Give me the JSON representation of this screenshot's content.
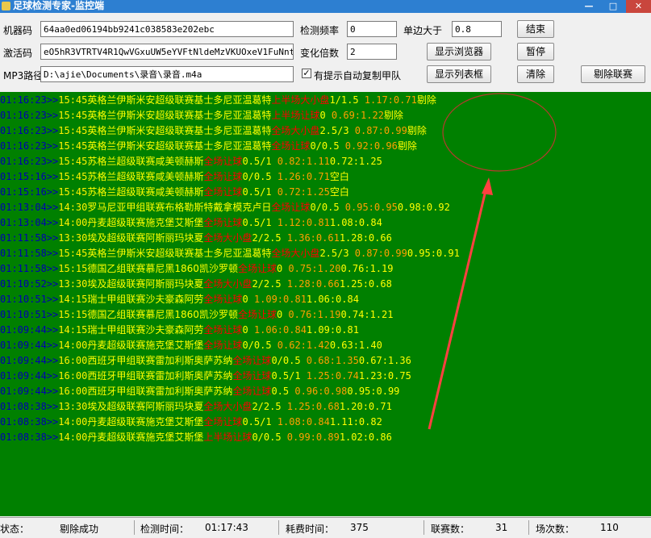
{
  "window": {
    "title": "足球检测专家-监控端",
    "minimize": "—",
    "maximize": "□",
    "close": "✕"
  },
  "form": {
    "machine_code_label": "机器码",
    "machine_code_value": "64aa0ed06194bb9241c038583e202ebc",
    "activation_code_label": "激活码",
    "activation_code_value": "eO5hR3VTRTV4R1QwVGxuUW5eYVFtNldeMzVKUOxeV1FuNnteVDVi",
    "mp3_path_label": "MP3路径",
    "mp3_path_value": "D:\\ajie\\Documents\\录音\\录音.m4a",
    "detect_freq_label": "检测频率",
    "detect_freq_value": "0",
    "change_mult_label": "变化倍数",
    "change_mult_value": "2",
    "auto_copy_label": "有提示自动复制甲队",
    "auto_copy_checked": true,
    "single_side_label": "单边大于",
    "single_side_value": "0.8"
  },
  "buttons": {
    "end": "结束",
    "show_browser": "显示浏览器",
    "pause": "暂停",
    "show_list": "显示列表框",
    "clear": "清除",
    "remove_league": "剔除联赛"
  },
  "log_rows": [
    {
      "t1": "01:16:23>>",
      "t2": "15:45",
      "league": "英格兰伊斯米安超级联赛",
      "home": "基士多尼亚",
      "away": "温葛特",
      "bet": "上半场大小盘",
      "line": "1/1.5",
      "o1": " 1.17:0.71",
      "o2": "",
      "status": "剔除"
    },
    {
      "t1": "01:16:23>>",
      "t2": "15:45",
      "league": "英格兰伊斯米安超级联赛",
      "home": "基士多尼亚",
      "away": "温葛特",
      "bet": "上半场让球",
      "line": "0",
      "o1": " 0.69:1.22",
      "o2": "",
      "status": "剔除"
    },
    {
      "t1": "01:16:23>>",
      "t2": "15:45",
      "league": "英格兰伊斯米安超级联赛",
      "home": "基士多尼亚",
      "away": "温葛特",
      "bet": "全场大小盘",
      "line": "2.5/3",
      "o1": " 0.87:0.99",
      "o2": "",
      "status": "剔除"
    },
    {
      "t1": "01:16:23>>",
      "t2": "15:45",
      "league": "英格兰伊斯米安超级联赛",
      "home": "基士多尼亚",
      "away": "温葛特",
      "bet": "全场让球",
      "line": "0/0.5",
      "o1": " 0.92:0.96",
      "o2": "",
      "status": "剔除"
    },
    {
      "t1": "01:16:23>>",
      "t2": "15:45",
      "league": "苏格兰超级联赛",
      "home": "咸美顿",
      "away": "赫斯",
      "bet": "全场让球",
      "line": "0.5/1",
      "o1": " 0.82:1.11",
      "o2": "0.72:1.25",
      "status": ""
    },
    {
      "t1": "01:15:16>>",
      "t2": "15:45",
      "league": "苏格兰超级联赛",
      "home": "咸美顿",
      "away": "赫斯",
      "bet": "全场让球",
      "line": "0/0.5",
      "o1": " 1.26:0.71",
      "o2": "",
      "status": "空白"
    },
    {
      "t1": "01:15:16>>",
      "t2": "15:45",
      "league": "苏格兰超级联赛",
      "home": "咸美顿",
      "away": "赫斯",
      "bet": "全场让球",
      "line": "0.5/1",
      "o1": " 0.72:1.25",
      "o2": "",
      "status": "空白"
    },
    {
      "t1": "01:13:04>>",
      "t2": "14:30",
      "league": "罗马尼亚甲组联赛",
      "home": "布格勒斯特戴拿模",
      "away": "克卢日",
      "bet": "全场让球",
      "line": "0/0.5",
      "o1": " 0.95:0.95",
      "o2": "0.98:0.92",
      "status": ""
    },
    {
      "t1": "01:13:04>>",
      "t2": "14:00",
      "league": "丹麦超级联赛",
      "home": "施克堡",
      "away": "艾斯堡",
      "bet": "全场让球",
      "line": "0.5/1",
      "o1": " 1.12:0.81",
      "o2": "1.08:0.84",
      "status": ""
    },
    {
      "t1": "01:11:58>>",
      "t2": "13:30",
      "league": "埃及超级联赛",
      "home": "阿斯丽",
      "away": "玛块夏",
      "bet": "全场大小盘",
      "line": "2/2.5",
      "o1": " 1.36:0.61",
      "o2": "1.28:0.66",
      "status": ""
    },
    {
      "t1": "01:11:58>>",
      "t2": "15:45",
      "league": "英格兰伊斯米安超级联赛",
      "home": "基士多尼亚",
      "away": "温葛特",
      "bet": "全场大小盘",
      "line": "2.5/3",
      "o1": " 0.87:0.99",
      "o2": "0.95:0.91",
      "status": ""
    },
    {
      "t1": "01:11:58>>",
      "t2": "15:15",
      "league": "德国乙组联赛",
      "home": "慕尼黑1860",
      "away": "凯沙罗顿",
      "bet": "全场让球",
      "line": "0",
      "o1": " 0.75:1.20",
      "o2": "0.76:1.19",
      "status": ""
    },
    {
      "t1": "01:10:52>>",
      "t2": "13:30",
      "league": "埃及超级联赛",
      "home": "阿斯丽",
      "away": "玛块夏",
      "bet": "全场大小盘",
      "line": "2/2.5",
      "o1": " 1.28:0.66",
      "o2": "1.25:0.68",
      "status": ""
    },
    {
      "t1": "01:10:51>>",
      "t2": "14:15",
      "league": "瑞士甲组联赛",
      "home": "沙夫豪森",
      "away": "阿劳",
      "bet": "全场让球",
      "line": "0",
      "o1": " 1.09:0.81",
      "o2": "1.06:0.84",
      "status": ""
    },
    {
      "t1": "01:10:51>>",
      "t2": "15:15",
      "league": "德国乙组联赛",
      "home": "慕尼黑1860",
      "away": "凯沙罗顿",
      "bet": "全场让球",
      "line": "0",
      "o1": " 0.76:1.19",
      "o2": "0.74:1.21",
      "status": ""
    },
    {
      "t1": "01:09:44>>",
      "t2": "14:15",
      "league": "瑞士甲组联赛",
      "home": "沙夫豪森",
      "away": "阿劳",
      "bet": "全场让球",
      "line": "0",
      "o1": " 1.06:0.84",
      "o2": "1.09:0.81",
      "status": ""
    },
    {
      "t1": "01:09:44>>",
      "t2": "14:00",
      "league": "丹麦超级联赛",
      "home": "施克堡",
      "away": "艾斯堡",
      "bet": "全场让球",
      "line": "0/0.5",
      "o1": " 0.62:1.42",
      "o2": "0.63:1.40",
      "status": ""
    },
    {
      "t1": "01:09:44>>",
      "t2": "16:00",
      "league": "西班牙甲组联赛",
      "home": "雷加利斯",
      "away": "奥萨苏纳",
      "bet": "全场让球",
      "line": "0/0.5",
      "o1": " 0.68:1.35",
      "o2": "0.67:1.36",
      "status": ""
    },
    {
      "t1": "01:09:44>>",
      "t2": "16:00",
      "league": "西班牙甲组联赛",
      "home": "雷加利斯",
      "away": "奥萨苏纳",
      "bet": "全场让球",
      "line": "0.5/1",
      "o1": " 1.25:0.74",
      "o2": "1.23:0.75",
      "status": ""
    },
    {
      "t1": "01:09:44>>",
      "t2": "16:00",
      "league": "西班牙甲组联赛",
      "home": "雷加利斯",
      "away": "奥萨苏纳",
      "bet": "全场让球",
      "line": "0.5",
      "o1": " 0.96:0.98",
      "o2": "0.95:0.99",
      "status": ""
    },
    {
      "t1": "01:08:38>>",
      "t2": "13:30",
      "league": "埃及超级联赛",
      "home": "阿斯丽",
      "away": "玛块夏",
      "bet": "全场大小盘",
      "line": "2/2.5",
      "o1": " 1.25:0.68",
      "o2": "1.20:0.71",
      "status": ""
    },
    {
      "t1": "01:08:38>>",
      "t2": "14:00",
      "league": "丹麦超级联赛",
      "home": "施克堡",
      "away": "艾斯堡",
      "bet": "全场让球",
      "line": "0.5/1",
      "o1": " 1.08:0.84",
      "o2": "1.11:0.82",
      "status": ""
    },
    {
      "t1": "01:08:38>>",
      "t2": "14:00",
      "league": "丹麦超级联赛",
      "home": "施克堡",
      "away": "艾斯堡",
      "bet": "上半场让球",
      "line": "0/0.5",
      "o1": " 0.99:0.89",
      "o2": "1.02:0.86",
      "status": ""
    }
  ],
  "statusbar": {
    "state_label": "状态：",
    "state_value": "剔除成功",
    "detect_time_label": "检测时间：",
    "detect_time_value": "01:17:43",
    "elapsed_label": "耗费时间：",
    "elapsed_value": "375",
    "league_count_label": "联赛数：",
    "league_count_value": "31",
    "match_count_label": "场次数：",
    "match_count_value": "110"
  },
  "colors": {
    "log_background": "#008000",
    "annotation": "#ff3b3b"
  }
}
